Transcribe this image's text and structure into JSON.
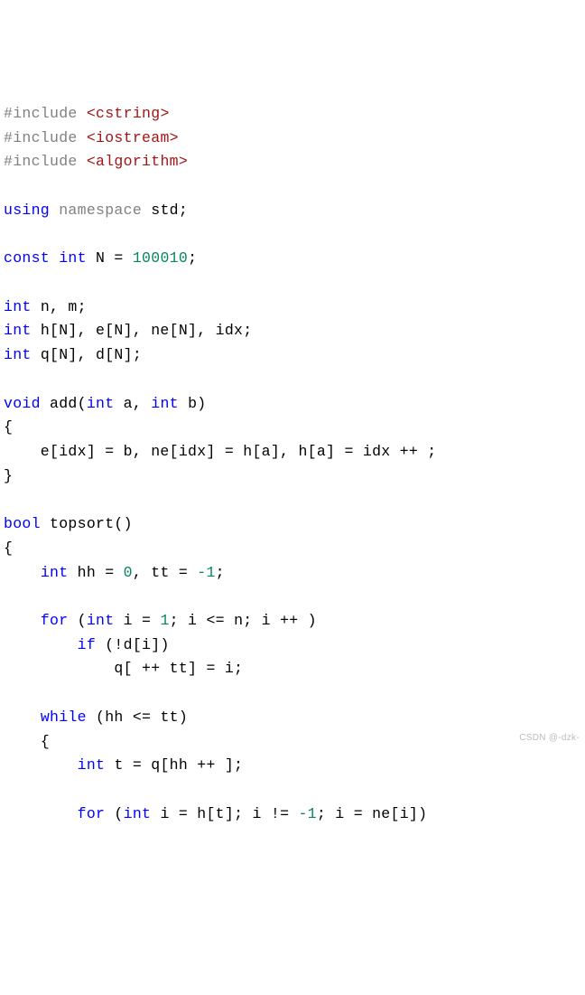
{
  "code": {
    "include1_kw": "#include",
    "include1_hdr": "<cstring>",
    "include2_kw": "#include",
    "include2_hdr": "<iostream>",
    "include3_kw": "#include",
    "include3_hdr": "<algorithm>",
    "using_kw": "using",
    "namespace_kw": "namespace",
    "std_ident": "std;",
    "const_kw": "const",
    "int_kw": "int",
    "N_decl": "N = ",
    "N_val": "100010",
    "semicolon": ";",
    "nm_decl": "n, m;",
    "arrays1": "h[N], e[N], ne[N], idx;",
    "arrays2": "q[N], d[N];",
    "void_kw": "void",
    "add_sig": "add(",
    "add_param1": "a, ",
    "add_param2": "b)",
    "lbrace": "{",
    "rbrace": "}",
    "add_body": "    e[idx] = b, ne[idx] = h[a], h[a] = idx ++ ;",
    "bool_kw": "bool",
    "topsort_sig": "topsort()",
    "hh_decl": "hh = ",
    "hh_val": "0",
    "tt_decl": ", tt = ",
    "tt_val": "-1",
    "for_kw": "for",
    "for1_init": " (",
    "for1_var": "i = ",
    "for1_start": "1",
    "for1_cond": "; i <= n; i ++ )",
    "if_kw": "if",
    "if1_cond": " (!d[i])",
    "q_assign": "q[ ++ tt] = i;",
    "while_kw": "while",
    "while_cond": " (hh <= tt)",
    "t_decl": "t = q[hh ++ ];",
    "for2_init": " (",
    "for2_var": "i = h[t]; i != ",
    "for2_neg1": "-1",
    "for2_rest": "; i = ne[i])"
  },
  "watermark": "CSDN @-dzk-"
}
